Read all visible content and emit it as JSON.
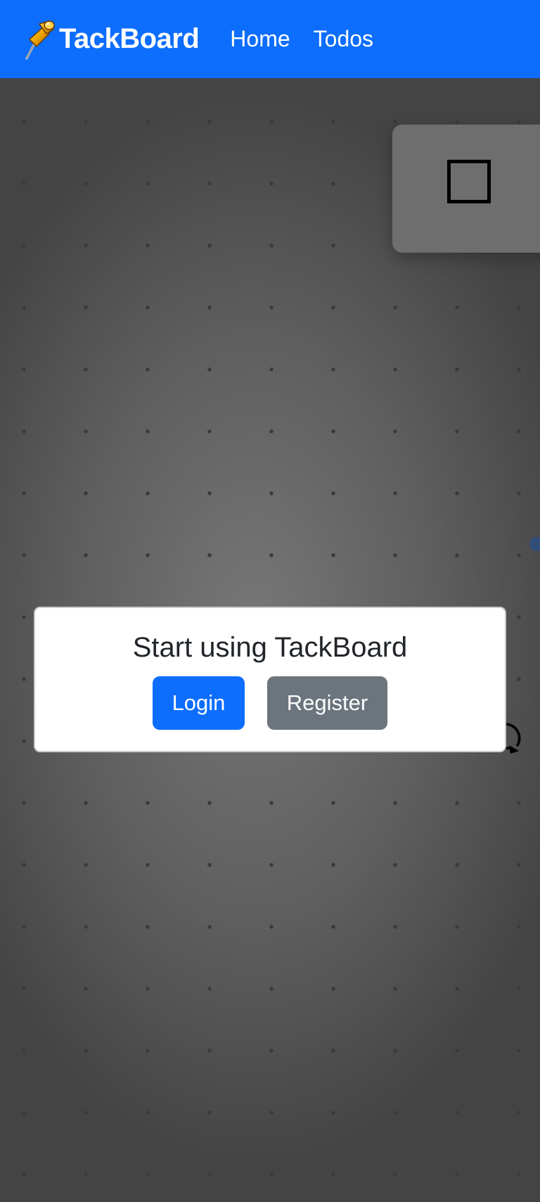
{
  "navbar": {
    "brand_icon": "pushpin-icon",
    "brand_name": "TackBoard",
    "links": [
      {
        "label": "Home"
      },
      {
        "label": "Todos"
      }
    ],
    "color": "#0d6efd"
  },
  "board": {
    "note_icon": "empty-checkbox-icon",
    "rotate_icon": "rotate-arrow-icon"
  },
  "modal": {
    "title": "Start using TackBoard",
    "login_label": "Login",
    "register_label": "Register",
    "login_color": "#0d6efd",
    "register_color": "#6c757d"
  }
}
